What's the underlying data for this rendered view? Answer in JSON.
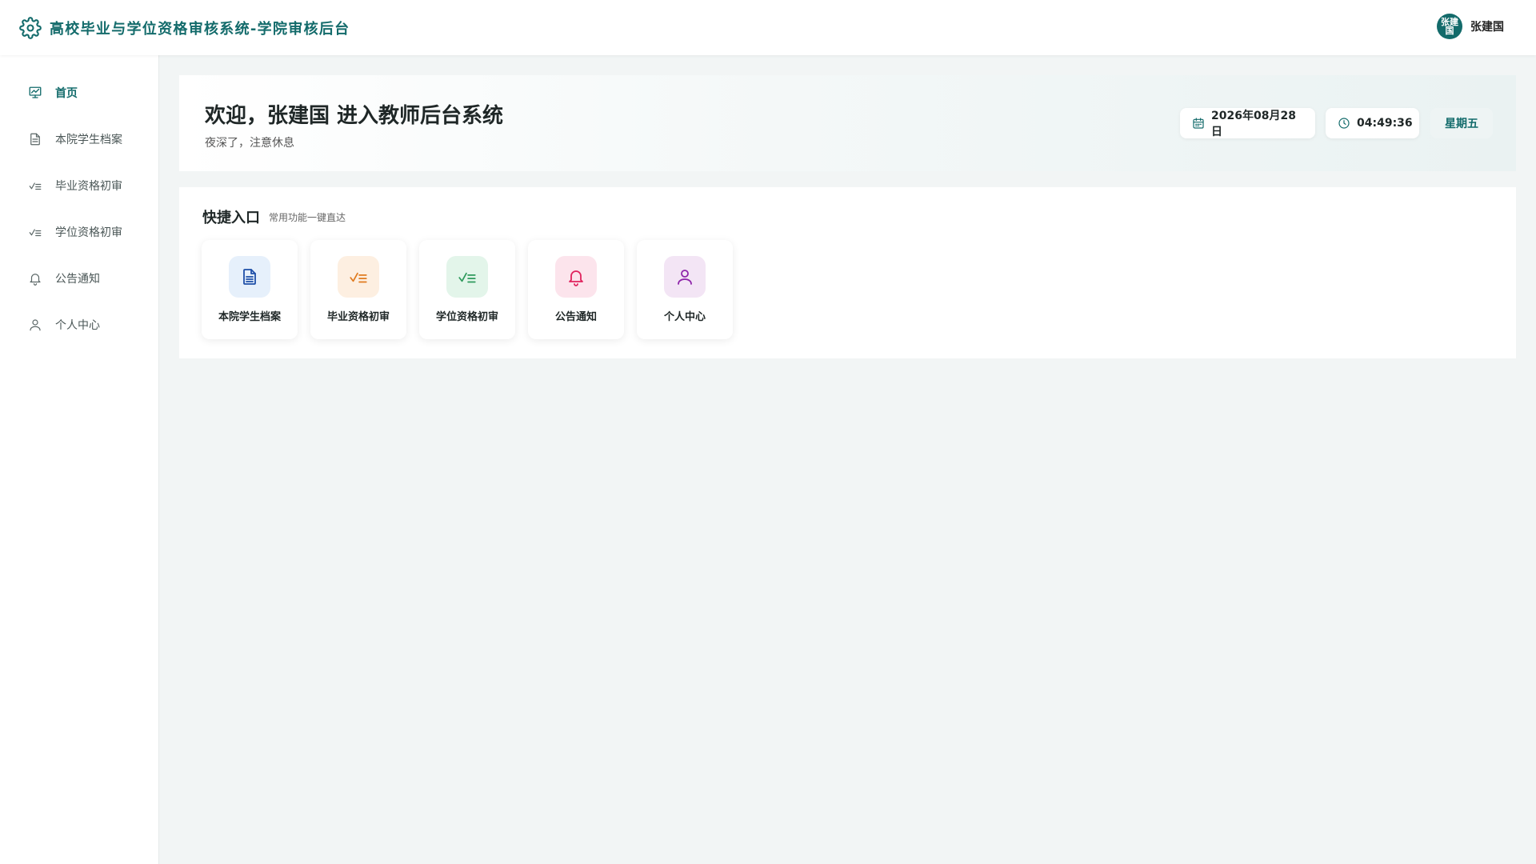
{
  "app": {
    "title": "高校毕业与学位资格审核系统-学院审核后台",
    "accent_color": "#136b6b"
  },
  "user": {
    "avatar_text": "张建国",
    "name": "张建国"
  },
  "sidebar": {
    "items": [
      {
        "label": "首页",
        "icon": "dashboard-icon",
        "active": true
      },
      {
        "label": "本院学生档案",
        "icon": "document-icon",
        "active": false
      },
      {
        "label": "毕业资格初审",
        "icon": "checklist-icon",
        "active": false
      },
      {
        "label": "学位资格初审",
        "icon": "checklist-icon",
        "active": false
      },
      {
        "label": "公告通知",
        "icon": "bell-icon",
        "active": false
      },
      {
        "label": "个人中心",
        "icon": "user-icon",
        "active": false
      }
    ]
  },
  "welcome": {
    "title": "欢迎，张建国 进入教师后台系统",
    "subtitle": "夜深了，注意休息",
    "date": "2026年08月28日",
    "time": "04:49:36",
    "weekday": "星期五"
  },
  "quick_access": {
    "title": "快捷入口",
    "subtitle": "常用功能一键直达",
    "cards": [
      {
        "label": "本院学生档案",
        "icon": "document-icon",
        "color": "#1e4fa8",
        "bg": "#e6f0fb"
      },
      {
        "label": "毕业资格初审",
        "icon": "checklist-icon",
        "color": "#e07b1f",
        "bg": "#fdefe1"
      },
      {
        "label": "学位资格初审",
        "icon": "checklist-icon",
        "color": "#2e9a5c",
        "bg": "#e3f5ea"
      },
      {
        "label": "公告通知",
        "icon": "bell-icon",
        "color": "#e0245e",
        "bg": "#fce4ec"
      },
      {
        "label": "个人中心",
        "icon": "user-icon",
        "color": "#8e24aa",
        "bg": "#f3e5f5"
      }
    ]
  }
}
